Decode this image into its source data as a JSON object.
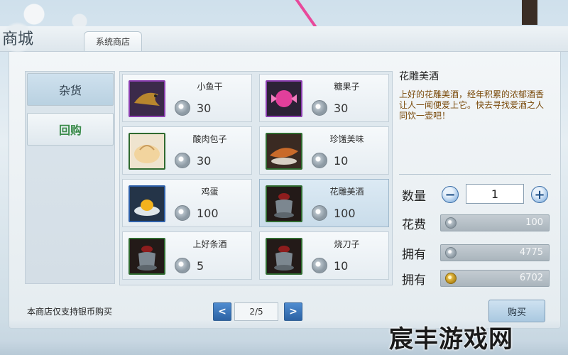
{
  "header": {
    "logo_text": "商城",
    "tab_label": "系统商店"
  },
  "categories": [
    {
      "label": "杂货",
      "active": true
    },
    {
      "label": "回购",
      "active": false
    }
  ],
  "items": [
    {
      "name": "小鱼干",
      "price": "30",
      "icon": "dried-fish-icon",
      "frame": "purple"
    },
    {
      "name": "糖果子",
      "price": "30",
      "icon": "candy-icon",
      "frame": "green"
    },
    {
      "name": "酸肉包子",
      "price": "30",
      "icon": "bun-icon",
      "frame": "green"
    },
    {
      "name": "珍馐美味",
      "price": "10",
      "icon": "grilled-fish-icon",
      "frame": "green"
    },
    {
      "name": "鸡蛋",
      "price": "100",
      "icon": "egg-icon",
      "frame": "blue"
    },
    {
      "name": "花雕美酒",
      "price": "100",
      "icon": "wine-jar-icon",
      "frame": "green",
      "selected": true
    },
    {
      "name": "上好条酒",
      "price": "5",
      "icon": "wine-jar-icon",
      "frame": "green"
    },
    {
      "name": "烧刀子",
      "price": "10",
      "icon": "wine-jar-icon",
      "frame": "green"
    }
  ],
  "detail": {
    "title": "花雕美酒",
    "description": "上好的花雕美酒，经年积累的浓郁酒香让人一闻便爱上它。快去寻找爱酒之人同饮一壶吧！",
    "quantity_label": "数量",
    "quantity_value": "1",
    "minus": "−",
    "plus": "+",
    "cost_label": "花费",
    "cost_value": "100",
    "owned_label_1": "拥有",
    "owned_value_1": "4775",
    "owned_label_2": "拥有",
    "owned_value_2": "6702"
  },
  "footer": {
    "note": "本商店仅支持银币购买",
    "prev": "<",
    "next": ">",
    "page": "2/5",
    "buy_label": "购买"
  },
  "watermark": "宸丰游戏网",
  "colors": {
    "accent_blue": "#2c62a4",
    "desc_text": "#7a4a0a",
    "active_green": "#3a8b4a"
  }
}
